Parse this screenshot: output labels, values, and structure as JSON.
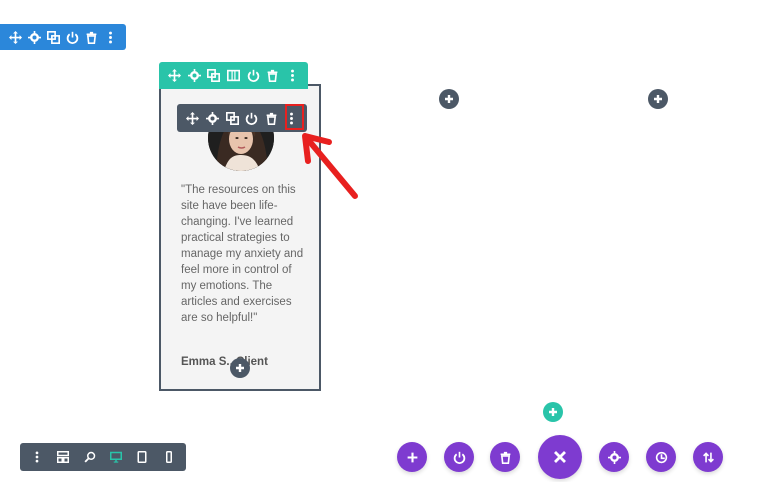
{
  "testimonial": {
    "quote": "\"The resources on this site have been life-changing. I've learned practical strategies to manage my anxiety and feel more in control of my emotions. The articles and exercises are so helpful!\"",
    "author": "Emma S., Client"
  },
  "icons": {
    "section_toolbar": [
      "move-icon",
      "gear-icon",
      "duplicate-icon",
      "power-icon",
      "trash-icon",
      "more-icon"
    ],
    "row_toolbar": [
      "move-icon",
      "gear-icon",
      "duplicate-icon",
      "columns-icon",
      "power-icon",
      "trash-icon",
      "more-icon"
    ],
    "module_toolbar": [
      "move-icon",
      "gear-icon",
      "duplicate-icon",
      "power-icon",
      "trash-icon",
      "more-icon"
    ],
    "view_toolbar": [
      "more-icon",
      "layers-icon",
      "zoom-icon",
      "desktop-icon",
      "tablet-icon",
      "phone-icon"
    ],
    "bottom_bar": [
      "add-icon",
      "power-icon",
      "trash-icon",
      "close-icon",
      "gear-icon",
      "history-icon",
      "portability-icon"
    ]
  },
  "colors": {
    "section": "#2b87da",
    "row": "#29c4a9",
    "module": "#4c5866",
    "builder": "#7e3bd0",
    "highlight": "#e8201f",
    "active_view": "#29c4a9"
  }
}
